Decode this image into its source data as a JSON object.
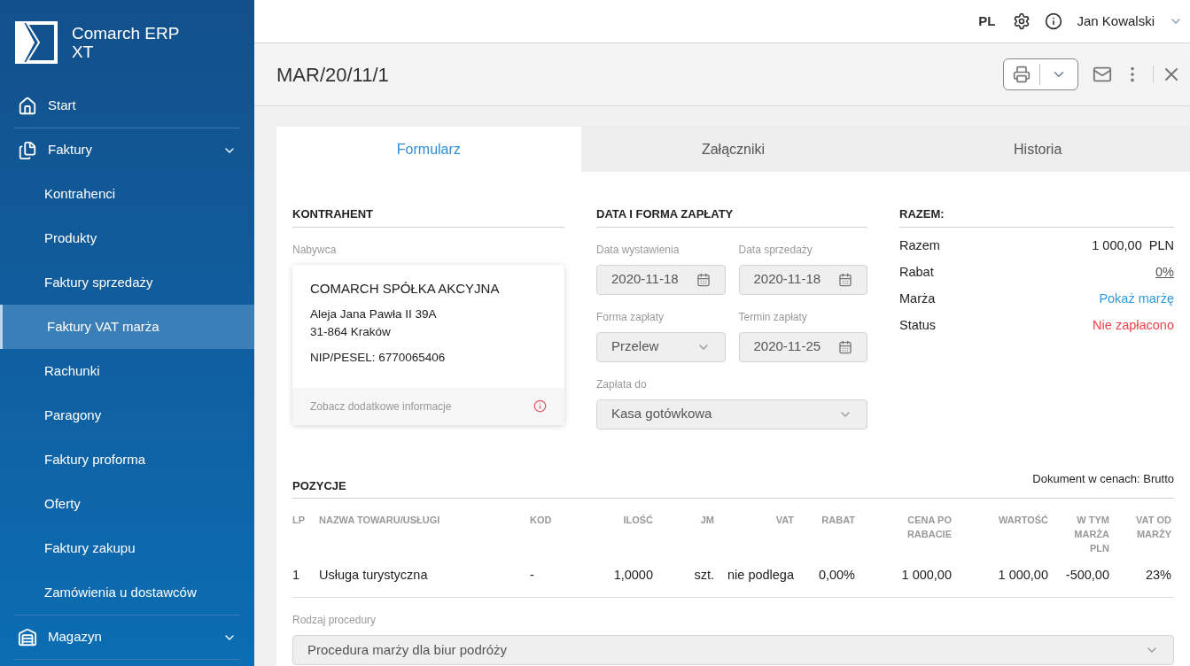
{
  "brand": {
    "name": "Comarch ERP XT"
  },
  "sidebar": {
    "items": [
      {
        "label": "Start",
        "kind": "home",
        "selected": false
      },
      {
        "label": "Faktury",
        "kind": "documents",
        "expanded": true,
        "selected": false,
        "children": [
          {
            "label": "Kontrahenci",
            "selected": false
          },
          {
            "label": "Produkty",
            "selected": false
          },
          {
            "label": "Faktury sprzedaży",
            "selected": false
          },
          {
            "label": "Faktury VAT marża",
            "selected": true
          },
          {
            "label": "Rachunki",
            "selected": false
          },
          {
            "label": "Paragony",
            "selected": false
          },
          {
            "label": "Faktury proforma",
            "selected": false
          },
          {
            "label": "Oferty",
            "selected": false
          },
          {
            "label": "Faktury zakupu",
            "selected": false
          },
          {
            "label": "Zamówienia u dostawców",
            "selected": false
          }
        ]
      },
      {
        "label": "Magazyn",
        "kind": "warehouse",
        "expanded": false,
        "selected": false
      }
    ]
  },
  "topbar": {
    "language": {
      "label": "PL",
      "selected": true
    },
    "user": "Jan Kowalski"
  },
  "document": {
    "title": "MAR/20/11/1"
  },
  "tabs": [
    {
      "label": "Formularz",
      "selected": true
    },
    {
      "label": "Załączniki",
      "selected": false
    },
    {
      "label": "Historia",
      "selected": false
    }
  ],
  "contractor": {
    "heading": "KONTRAHENT",
    "label": "Nabywca",
    "name": "COMARCH SPÓŁKA AKCYJNA",
    "address_lines": [
      "Aleja Jana Pawła II 39A",
      "31-864 Kraków"
    ],
    "tax_id": "NIP/PESEL: 6770065406",
    "more_link": "Zobacz dodatkowe informacje"
  },
  "payment": {
    "heading": "DATA I FORMA ZAPŁATY",
    "rows": [
      [
        {
          "kind": "date",
          "label": "Data wystawienia",
          "value": "2020-11-18"
        },
        {
          "kind": "date",
          "label": "Data sprzedaży",
          "value": "2020-11-18"
        }
      ],
      [
        {
          "kind": "select",
          "label": "Forma zapłaty",
          "value": "Przelew"
        },
        {
          "kind": "date",
          "label": "Termin zapłaty",
          "value": "2020-11-25"
        }
      ],
      [
        {
          "kind": "select",
          "label": "Zapłata do",
          "value": "Kasa gotówkowa"
        }
      ]
    ]
  },
  "summary": {
    "heading": "RAZEM:",
    "rows": [
      {
        "label": "Razem",
        "value": "1 000,00  PLN",
        "kind": "plain"
      },
      {
        "label": "Rabat",
        "value": "0%",
        "kind": "underline"
      },
      {
        "label": "Marża",
        "value": "Pokaż marżę",
        "kind": "link"
      },
      {
        "label": "Status",
        "value": "Nie zapłacono",
        "kind": "alert"
      }
    ]
  },
  "positions": {
    "heading": "POZYCJE",
    "price_mode": "Dokument w cenach: Brutto",
    "columns": [
      "LP",
      "NAZWA TOWARU/USŁUGI",
      "KOD",
      "ILOŚĆ",
      "JM",
      "VAT",
      "RABAT",
      "CENA PO RABACIE",
      "WARTOŚĆ",
      "W TYM MARŻA PLN",
      "VAT OD MARŻY"
    ],
    "rows": [
      [
        "1",
        "Usługa turystyczna",
        "-",
        "1,0000",
        "szt.",
        "nie podlega",
        "0,00%",
        "1 000,00",
        "1 000,00",
        "-500,00",
        "23%"
      ]
    ]
  },
  "procedure": {
    "label": "Rodzaj procedury",
    "value": "Procedura marży dla biur podróży"
  }
}
